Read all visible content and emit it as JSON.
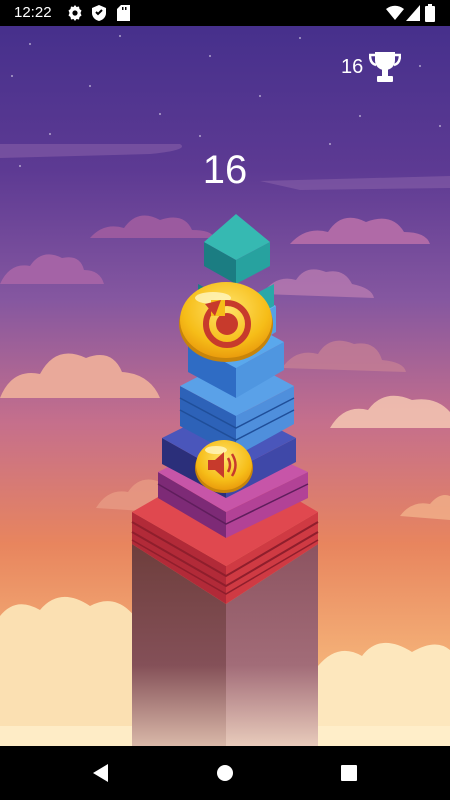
{
  "status_bar": {
    "time": "12:22",
    "icons": [
      "gear-icon",
      "shield-icon",
      "sd-card-icon",
      "wifi-icon",
      "cell-signal-icon",
      "battery-icon"
    ]
  },
  "game": {
    "best_score": "16",
    "score": "16",
    "buttons": {
      "restart_icon": "restart-icon",
      "sound_icon": "speaker-icon"
    }
  },
  "nav_bar": {
    "icons": [
      "back-triangle-icon",
      "home-circle-icon",
      "recents-square-icon"
    ]
  },
  "colors": {
    "sky_top": "#4b3290",
    "sky_mid": "#8a5aa0",
    "sky_low": "#e07a5b",
    "sky_bottom": "#f7c887",
    "button_yellow": "#f6c41a",
    "button_red": "#c8402e"
  }
}
